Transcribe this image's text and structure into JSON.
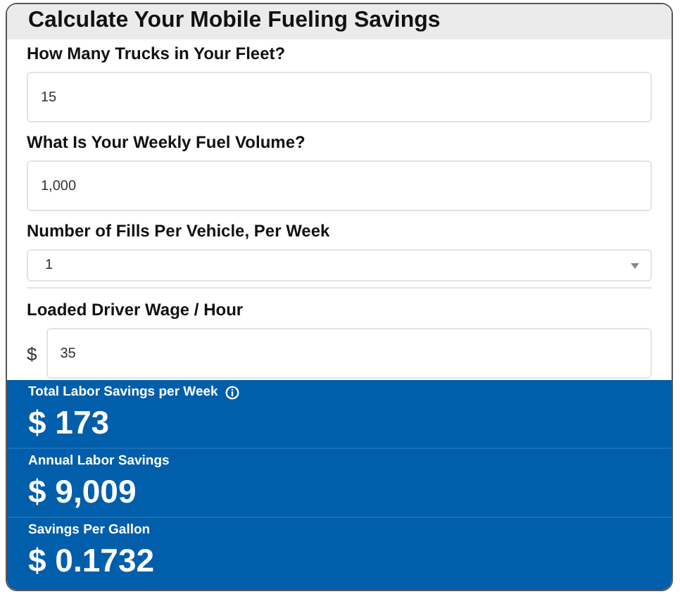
{
  "title": "Calculate Your Mobile Fueling Savings",
  "fields": [
    {
      "kind": "text",
      "label": "How Many Trucks in Your Fleet?",
      "value": "15"
    },
    {
      "kind": "text",
      "label": "What Is Your Weekly Fuel Volume?",
      "value": "1,000"
    },
    {
      "kind": "select",
      "label": "Number of Fills Per Vehicle, Per Week",
      "value": "1"
    },
    {
      "kind": "currency",
      "label": "Loaded Driver Wage / Hour",
      "prefix": "$",
      "value": "35"
    }
  ],
  "results": [
    {
      "label": "Total Labor Savings per Week",
      "info": true,
      "value": "$ 173"
    },
    {
      "label": "Annual Labor Savings",
      "info": false,
      "value": "$ 9,009"
    },
    {
      "label": "Savings Per Gallon",
      "info": false,
      "value": "$ 0.1732"
    }
  ]
}
